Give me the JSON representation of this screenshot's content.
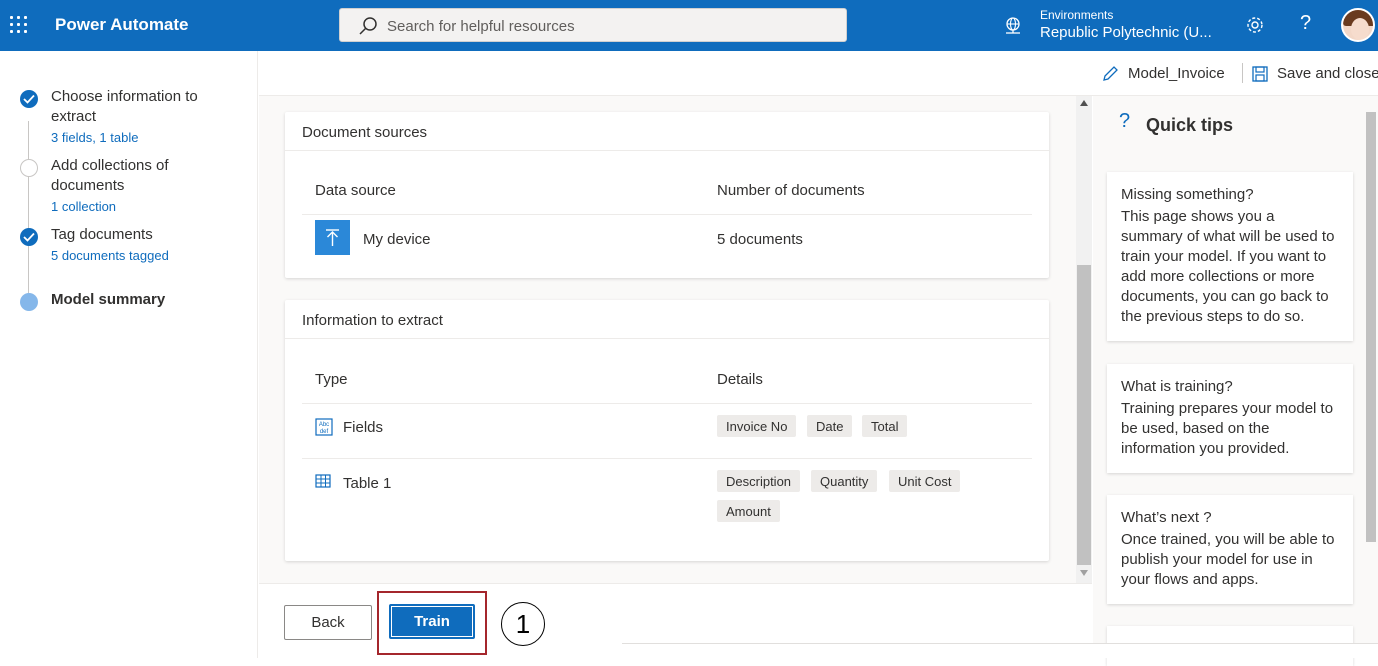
{
  "header": {
    "app_title": "Power Automate",
    "search_placeholder": "Search for helpful resources",
    "environments_label": "Environments",
    "environment_name": "Republic Polytechnic (U..."
  },
  "steps": [
    {
      "title": "Choose information to extract",
      "sub": "3 fields, 1 table",
      "state": "done"
    },
    {
      "title": "Add collections of documents",
      "sub": "1 collection",
      "state": "pending"
    },
    {
      "title": "Tag documents",
      "sub": "5 documents tagged",
      "state": "done"
    },
    {
      "title": "Model summary",
      "sub": "",
      "state": "current"
    }
  ],
  "command_bar": {
    "model_name": "Model_Invoice",
    "save_label": "Save and close"
  },
  "document_sources": {
    "title": "Document sources",
    "col_source": "Data source",
    "col_count": "Number of documents",
    "rows": [
      {
        "source": "My device",
        "count": "5 documents"
      }
    ]
  },
  "information": {
    "title": "Information to extract",
    "col_type": "Type",
    "col_details": "Details",
    "fields_label": "Fields",
    "fields": [
      "Invoice No",
      "Date",
      "Total"
    ],
    "table_label": "Table 1",
    "table_columns": [
      "Description",
      "Quantity",
      "Unit Cost",
      "Amount"
    ]
  },
  "tips": {
    "title": "Quick tips",
    "items": [
      {
        "heading": "Missing something?",
        "body": "This page shows you a summary of what will be used to train your model. If you want to add more collections or more documents, you can go back to the previous steps to do so."
      },
      {
        "heading": "What is training?",
        "body": "Training prepares your model to be used, based on the information you provided."
      },
      {
        "heading": "What’s next ?",
        "body": "Once trained, you will be able to publish your model for use in your flows and apps."
      }
    ]
  },
  "footer": {
    "back_label": "Back",
    "train_label": "Train",
    "annotation_number": "1"
  },
  "colors": {
    "brand_blue": "#0f6cbd",
    "highlight_red": "#a4262c"
  }
}
